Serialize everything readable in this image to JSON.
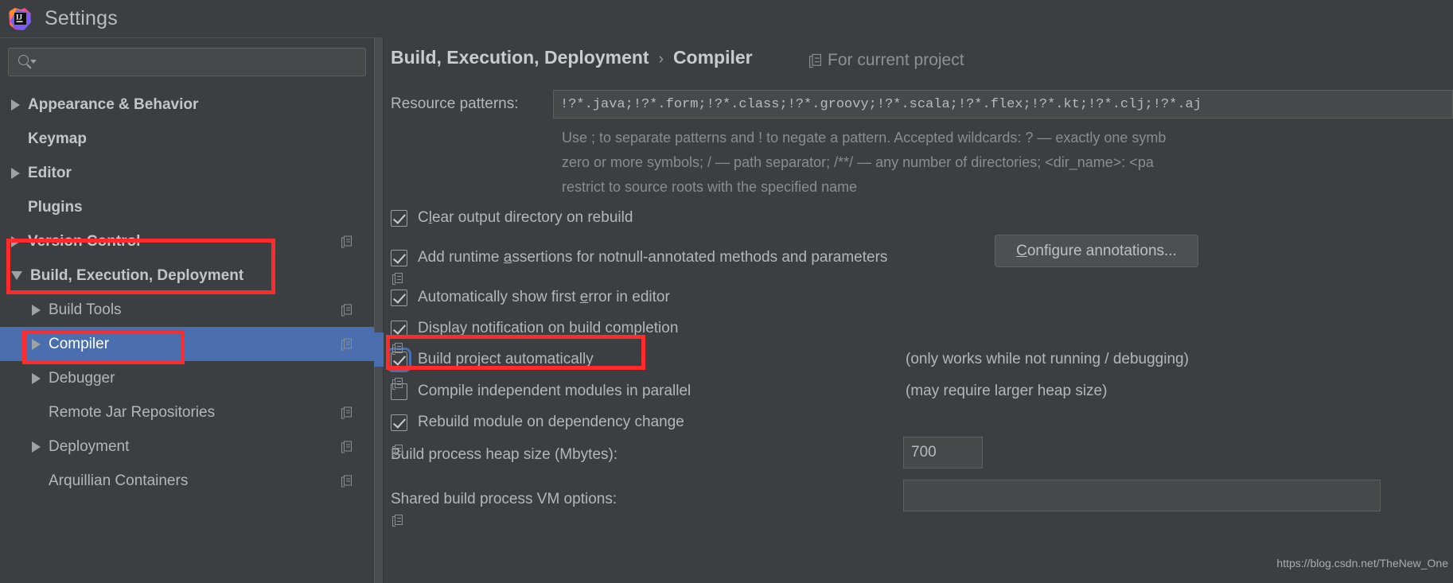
{
  "window": {
    "title": "Settings",
    "logo_icon": "intellij-idea-logo"
  },
  "sidebar": {
    "search": {
      "value": "",
      "placeholder": "",
      "icon": "search-icon"
    },
    "items": [
      {
        "label": "Appearance & Behavior",
        "arrow": "collapsed",
        "indent": 0,
        "bold": true,
        "selected": false,
        "gutter_icon": ""
      },
      {
        "label": "Keymap",
        "arrow": "none",
        "indent": 0,
        "bold": true,
        "selected": false,
        "gutter_icon": ""
      },
      {
        "label": "Editor",
        "arrow": "collapsed",
        "indent": 0,
        "bold": true,
        "selected": false,
        "gutter_icon": ""
      },
      {
        "label": "Plugins",
        "arrow": "none",
        "indent": 0,
        "bold": true,
        "selected": false,
        "gutter_icon": ""
      },
      {
        "label": "Version Control",
        "arrow": "collapsed",
        "indent": 0,
        "bold": true,
        "selected": false,
        "gutter_icon": "module-icon"
      },
      {
        "label": "Build, Execution, Deployment",
        "arrow": "expanded",
        "indent": 0,
        "bold": true,
        "selected": false,
        "gutter_icon": ""
      },
      {
        "label": "Build Tools",
        "arrow": "collapsed",
        "indent": 1,
        "bold": false,
        "selected": false,
        "gutter_icon": "module-icon"
      },
      {
        "label": "Compiler",
        "arrow": "collapsed",
        "indent": 1,
        "bold": false,
        "selected": true,
        "gutter_icon": "module-icon"
      },
      {
        "label": "Debugger",
        "arrow": "collapsed",
        "indent": 1,
        "bold": false,
        "selected": false,
        "gutter_icon": ""
      },
      {
        "label": "Remote Jar Repositories",
        "arrow": "none",
        "indent": 1,
        "bold": false,
        "selected": false,
        "gutter_icon": "module-icon"
      },
      {
        "label": "Deployment",
        "arrow": "collapsed",
        "indent": 1,
        "bold": false,
        "selected": false,
        "gutter_icon": "module-icon"
      },
      {
        "label": "Arquillian Containers",
        "arrow": "none",
        "indent": 1,
        "bold": false,
        "selected": false,
        "gutter_icon": "module-icon"
      }
    ]
  },
  "main": {
    "breadcrumb": {
      "parent": "Build, Execution, Deployment",
      "separator": "›",
      "current": "Compiler"
    },
    "for_current_project": {
      "label": "For current project",
      "icon": "module-icon"
    },
    "resource_patterns": {
      "label": "Resource patterns:",
      "value": "!?*.java;!?*.form;!?*.class;!?*.groovy;!?*.scala;!?*.flex;!?*.kt;!?*.clj;!?*.aj",
      "placeholder": ""
    },
    "hint_lines": [
      "Use ; to separate patterns and ! to negate a pattern. Accepted wildcards: ? — exactly one symb",
      "zero or more symbols; / — path separator; /**/ — any number of directories; <dir_name>: <pa",
      "restrict to source roots with the specified name"
    ],
    "checkboxes": [
      {
        "label": "Clear output directory on rebuild",
        "mnemonic": "l",
        "checked": true,
        "focused": false,
        "note": ""
      },
      {
        "label": "Add runtime assertions for notnull-annotated methods and parameters",
        "mnemonic": "a",
        "checked": true,
        "focused": false,
        "note": ""
      },
      {
        "label": "Automatically show first error in editor",
        "mnemonic": "e",
        "checked": true,
        "focused": false,
        "note": ""
      },
      {
        "label": "Display notification on build completion",
        "mnemonic": "",
        "checked": true,
        "focused": false,
        "note": ""
      },
      {
        "label": "Build project automatically",
        "mnemonic": "",
        "checked": true,
        "focused": true,
        "note": "(only works while not running / debugging)"
      },
      {
        "label": "Compile independent modules in parallel",
        "mnemonic": "",
        "checked": false,
        "focused": false,
        "note": "(may require larger heap size)"
      },
      {
        "label": "Rebuild module on dependency change",
        "mnemonic": "",
        "checked": true,
        "focused": false,
        "note": ""
      }
    ],
    "configure_annotations_button": {
      "label": "Configure annotations...",
      "mnemonic": "C"
    },
    "heap_size": {
      "label": "Build process heap size (Mbytes):",
      "value": "700"
    },
    "vm_options": {
      "label": "Shared build process VM options:",
      "value": ""
    }
  },
  "annotations": {
    "color": "#fd2b2b",
    "boxes": [
      {
        "name": "annotation-build-execution-deployment"
      },
      {
        "name": "annotation-compiler"
      },
      {
        "name": "annotation-build-project-automatically"
      }
    ]
  },
  "watermark": {
    "text": "https://blog.csdn.net/TheNew_One"
  }
}
